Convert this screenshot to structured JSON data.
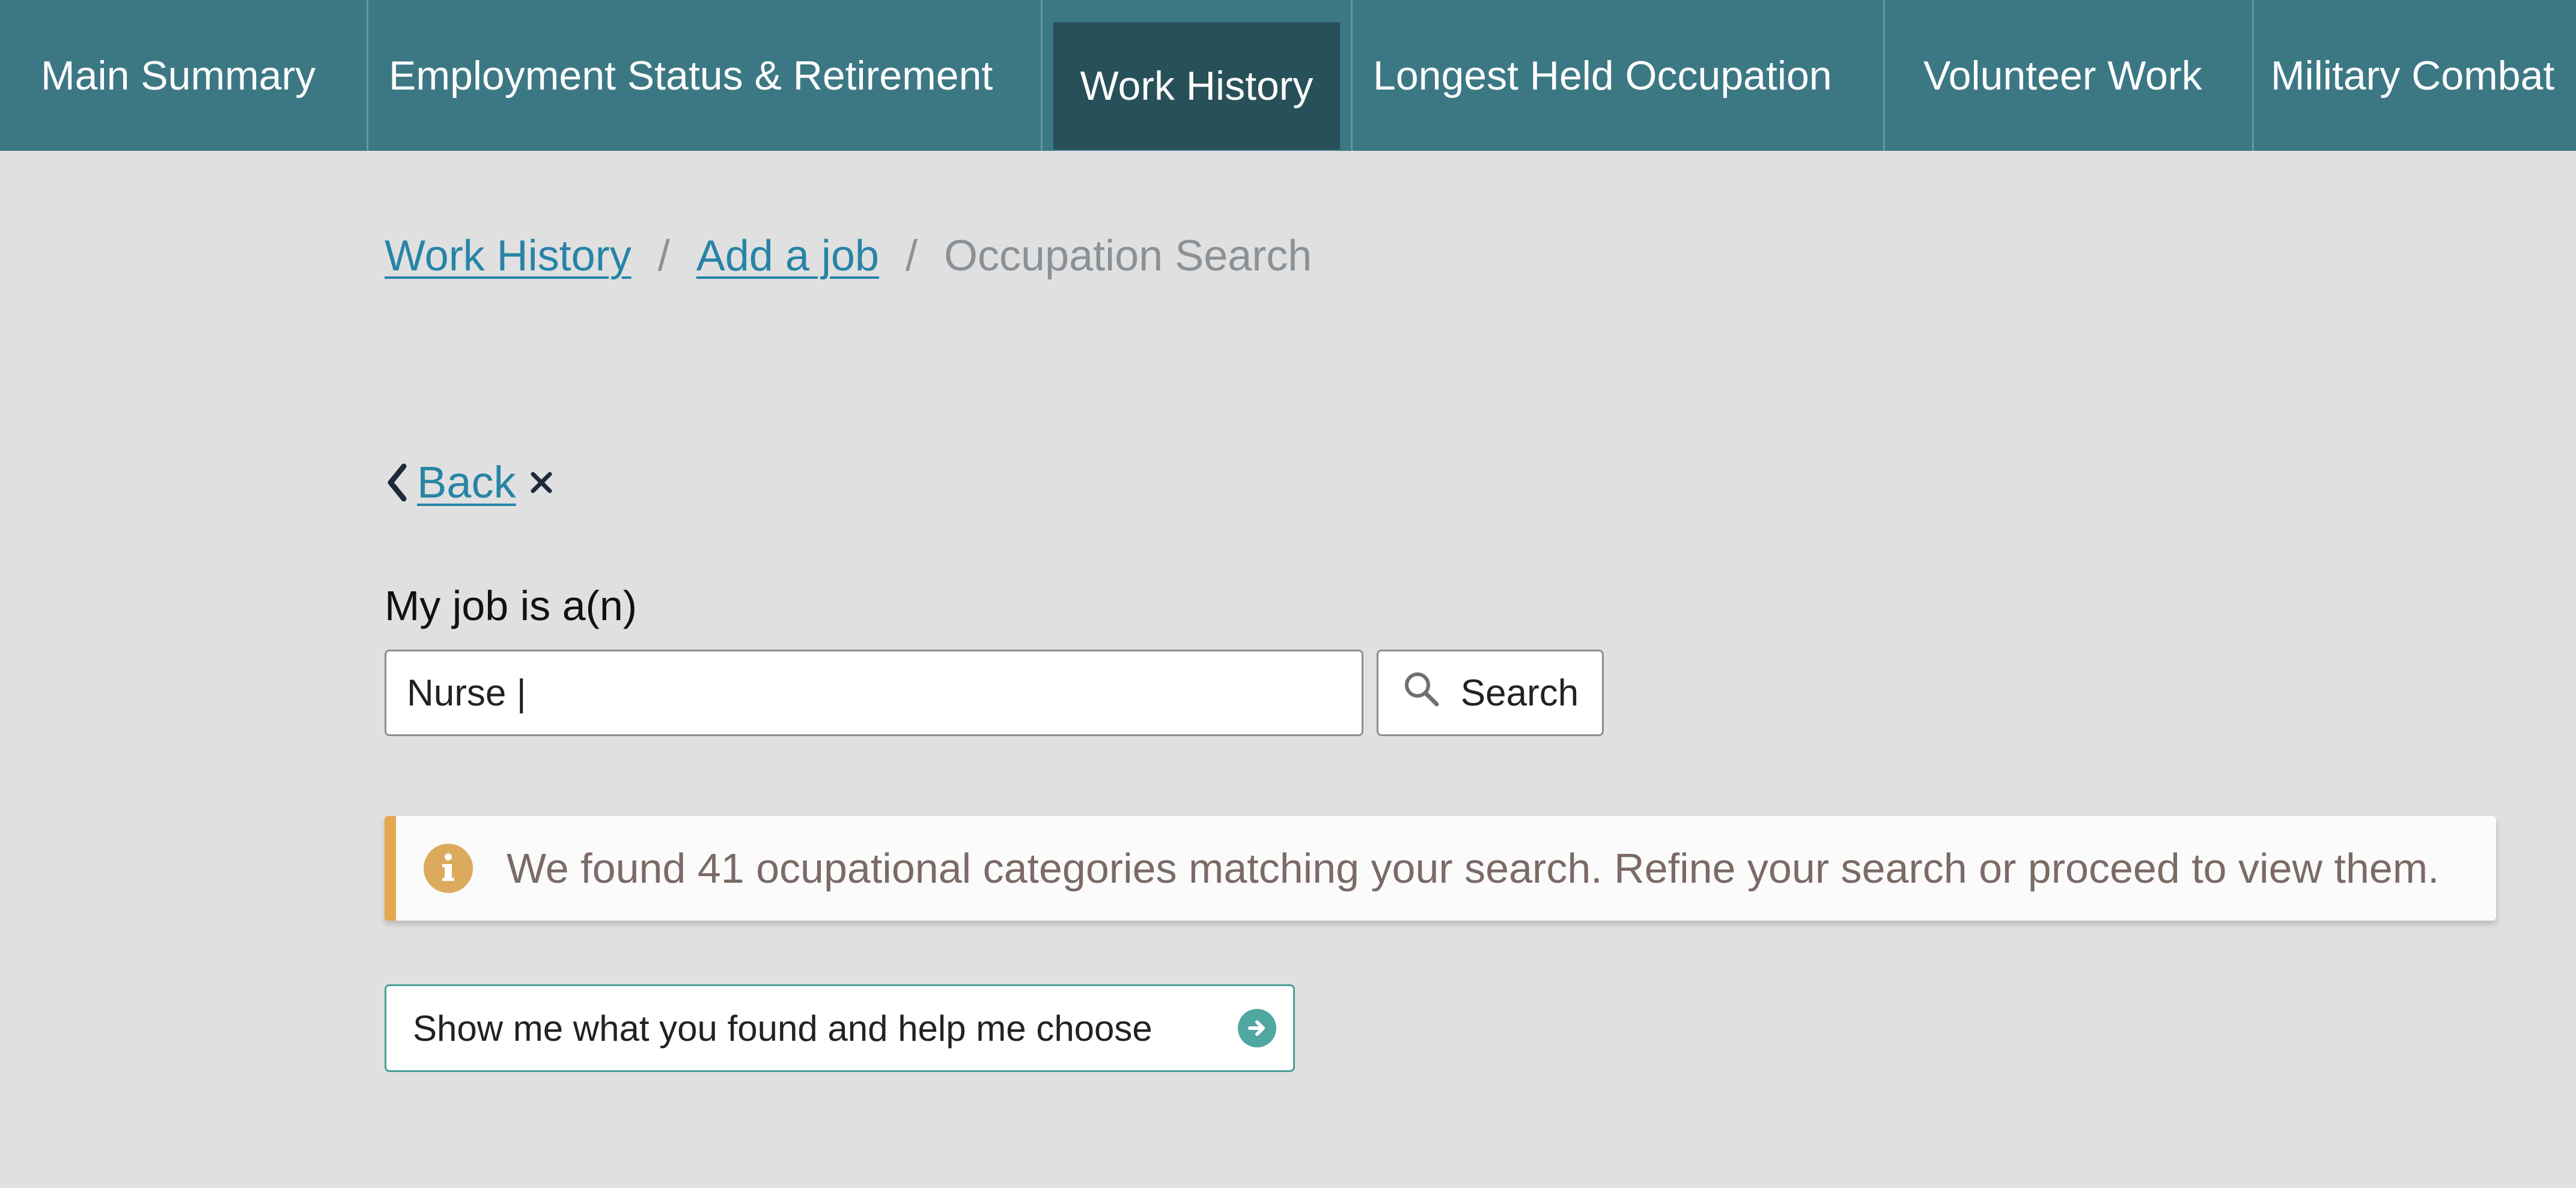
{
  "nav": {
    "tabs": [
      {
        "label": "Main Summary"
      },
      {
        "label": "Employment Status & Retirement"
      },
      {
        "label": "Work History",
        "active": true
      },
      {
        "label": "Longest Held Occupation"
      },
      {
        "label": "Volunteer Work"
      },
      {
        "label": "Military Combat"
      }
    ]
  },
  "breadcrumb": {
    "items": [
      {
        "label": "Work History",
        "link": true
      },
      {
        "label": "Add a job",
        "link": true
      },
      {
        "label": "Occupation Search",
        "link": false
      }
    ],
    "separator": "/"
  },
  "back": {
    "label": "Back",
    "chevron_icon": "chevron-left-icon",
    "close_icon": "close-icon"
  },
  "form": {
    "label": "My job is a(n)",
    "value": "Nurse |",
    "search_label": "Search",
    "search_icon": "search-icon"
  },
  "alert": {
    "icon": "info-icon",
    "message": "We found 41 ocupational categories matching your search. Refine your search or proceed to view them."
  },
  "action": {
    "label": "Show me what you found and help me choose",
    "icon": "arrow-right-circle-icon"
  },
  "colors": {
    "nav_bg": "#3c7884",
    "nav_active": "#285058",
    "link": "#2784a6",
    "alert_accent": "#e4a94f",
    "action_border": "#4aa096",
    "page_bg": "#e0e0e0"
  }
}
